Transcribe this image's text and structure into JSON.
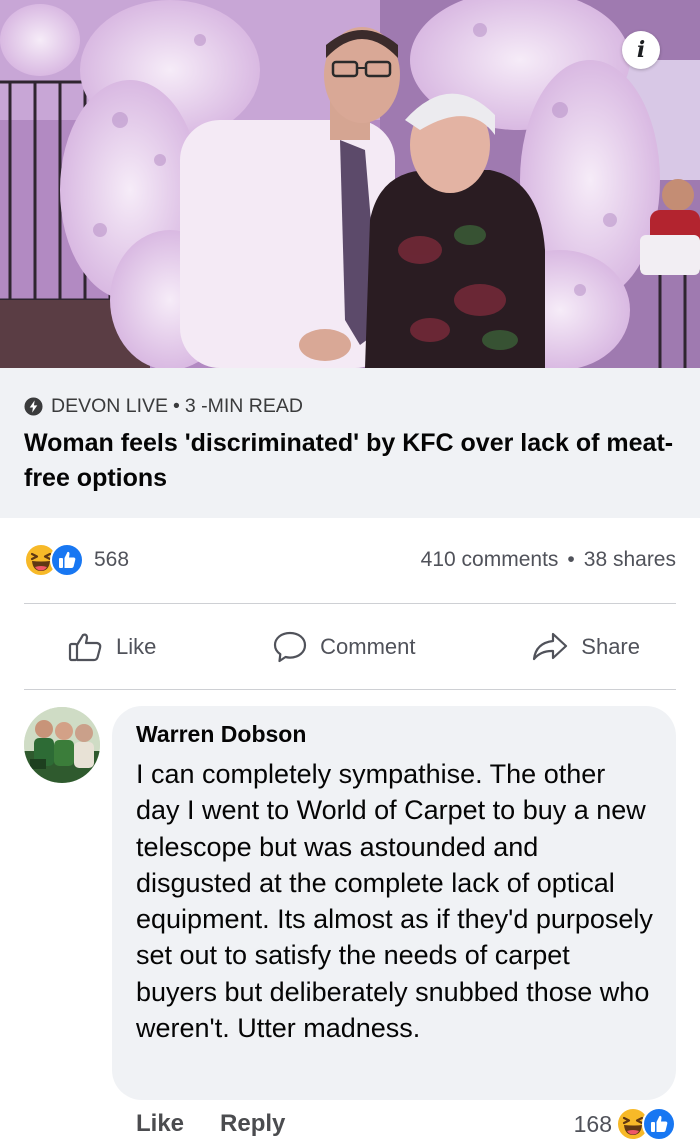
{
  "post": {
    "source": "DEVON LIVE",
    "separator": "•",
    "read_time": "3 -MIN READ",
    "headline": "Woman feels 'discriminated' by KFC over lack of meat-free options"
  },
  "reactions": {
    "count": "568",
    "comments": "410 comments",
    "separator": "•",
    "shares": "38 shares"
  },
  "actions": {
    "like": "Like",
    "comment": "Comment",
    "share": "Share"
  },
  "comment": {
    "author": "Warren Dobson",
    "text": "I can completely sympathise. The other day I went to World of Carpet to buy a new telescope but was astounded and disgusted at the complete lack of optical equipment. Its almost as if they'd purposely set out to satisfy the needs of carpet buyers but deliberately snubbed those who weren't. Utter madness.",
    "like": "Like",
    "reply": "Reply",
    "reaction_count": "168"
  },
  "icons": {
    "info": "info-icon",
    "source": "lightning-icon",
    "haha": "haha-emoji-icon",
    "like_reaction": "like-reaction-icon",
    "like_action": "thumbs-up-icon",
    "comment_action": "comment-bubble-icon",
    "share_action": "share-arrow-icon"
  },
  "colors": {
    "accent_blue": "#1877f2",
    "haha_yellow": "#f7b928",
    "bubble_gray": "#f0f2f5",
    "secondary_text": "#50525a"
  }
}
